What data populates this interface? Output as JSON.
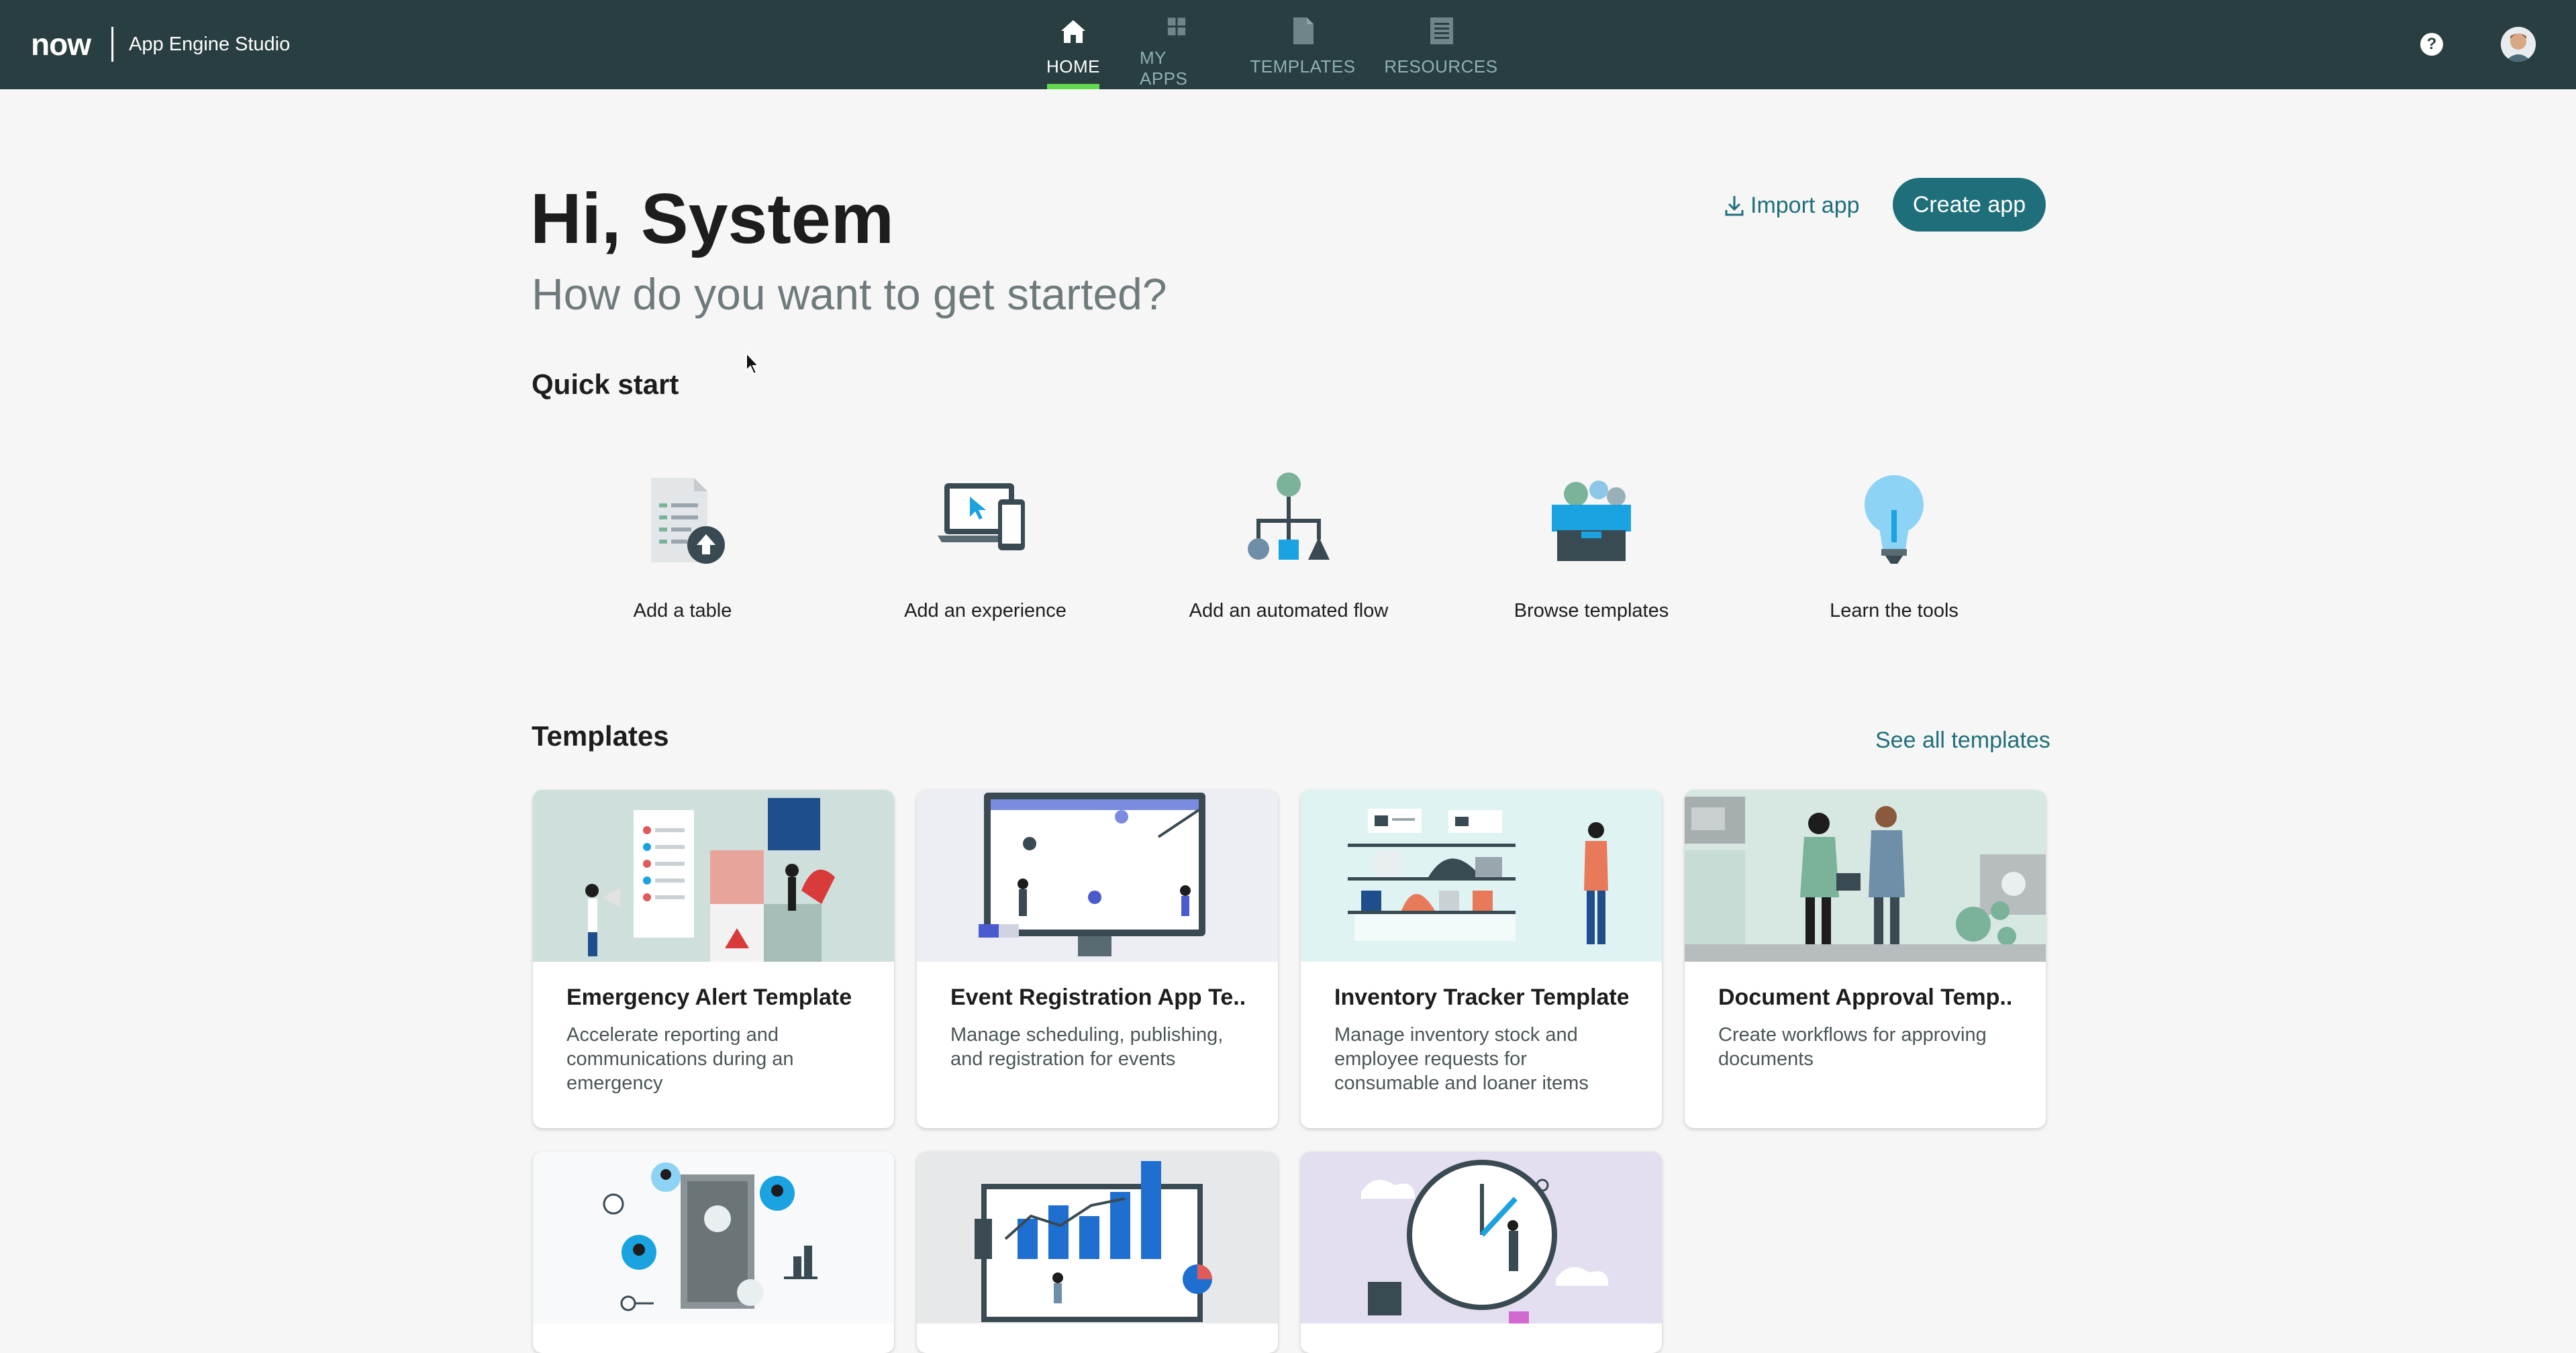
{
  "header": {
    "logo": "now",
    "app_title": "App Engine Studio",
    "nav": [
      {
        "label": "HOME",
        "icon": "home-icon",
        "active": true
      },
      {
        "label": "MY APPS",
        "icon": "grid-icon",
        "active": false
      },
      {
        "label": "TEMPLATES",
        "icon": "document-icon",
        "active": false
      },
      {
        "label": "RESOURCES",
        "icon": "book-icon",
        "active": false
      }
    ],
    "help_label": "?"
  },
  "hero": {
    "greeting": "Hi, System",
    "subtitle": "How do you want to get started?",
    "import_label": "Import app",
    "create_label": "Create app"
  },
  "quick_start": {
    "title": "Quick start",
    "items": [
      {
        "label": "Add a table",
        "icon": "table-upload-icon"
      },
      {
        "label": "Add an experience",
        "icon": "devices-icon"
      },
      {
        "label": "Add an automated flow",
        "icon": "flow-icon"
      },
      {
        "label": "Browse templates",
        "icon": "templates-box-icon"
      },
      {
        "label": "Learn the tools",
        "icon": "lightbulb-icon"
      }
    ]
  },
  "templates": {
    "title": "Templates",
    "see_all": "See all templates",
    "cards": [
      {
        "title": "Emergency Alert Template",
        "desc": "Accelerate reporting and communications during an emergency"
      },
      {
        "title": "Event Registration App Te...",
        "desc": "Manage scheduling, publishing, and registration for events"
      },
      {
        "title": "Inventory Tracker Template",
        "desc": "Manage inventory stock and employee requests for consumable and loaner items"
      },
      {
        "title": "Document Approval Temp...",
        "desc": "Create workflows for approving documents"
      }
    ]
  },
  "colors": {
    "topbar": "#293e40",
    "accent": "#1f6f7a",
    "active_tab": "#62d84e"
  }
}
